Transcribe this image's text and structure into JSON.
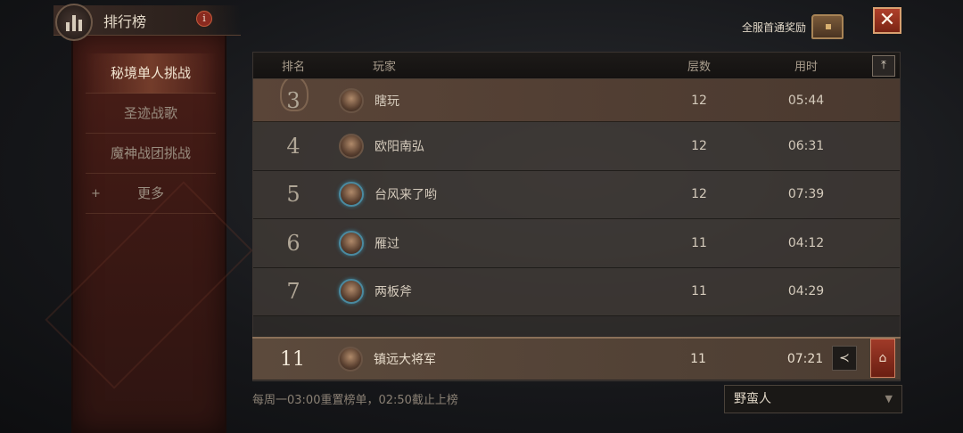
{
  "header": {
    "title": "排行榜",
    "info_icon": "i"
  },
  "menu": {
    "items": [
      {
        "label": "秘境单人挑战",
        "active": true
      },
      {
        "label": "圣迹战歌",
        "active": false
      },
      {
        "label": "魔神战团挑战",
        "active": false
      },
      {
        "label": "更多",
        "active": false,
        "prefix": "+"
      }
    ]
  },
  "top": {
    "reward_label": "全服首通奖励",
    "close_icon": "✕"
  },
  "table": {
    "headers": {
      "rank": "排名",
      "player": "玩家",
      "layer": "层数",
      "time": "用时"
    },
    "top_button_icon": "⤒",
    "rows": [
      {
        "rank": "3",
        "name": "瞎玩",
        "layer": "12",
        "time": "05:44"
      },
      {
        "rank": "4",
        "name": "欧阳南弘",
        "layer": "12",
        "time": "06:31"
      },
      {
        "rank": "5",
        "name": "台风来了哟",
        "layer": "12",
        "time": "07:39"
      },
      {
        "rank": "6",
        "name": "雁过",
        "layer": "11",
        "time": "04:12"
      },
      {
        "rank": "7",
        "name": "两板斧",
        "layer": "11",
        "time": "04:29"
      }
    ]
  },
  "self": {
    "rank": "11",
    "name": "镇远大将军",
    "layer": "11",
    "time": "07:21",
    "share_icon": "≺",
    "locate_icon": "⌂"
  },
  "footer": {
    "note": "每周一03:00重置榜单，02:50截止上榜"
  },
  "class_select": {
    "value": "野蛮人",
    "caret": "▼"
  }
}
